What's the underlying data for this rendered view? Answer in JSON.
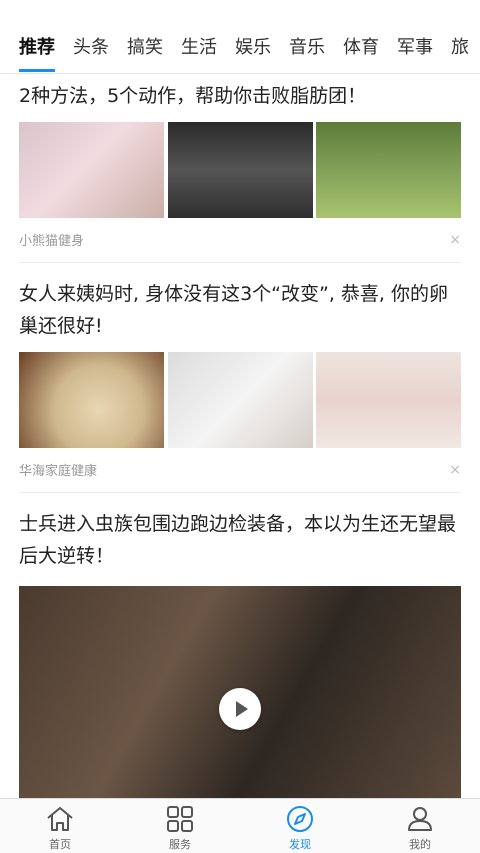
{
  "tabs": {
    "items": [
      {
        "label": "推荐",
        "active": true
      },
      {
        "label": "头条",
        "active": false
      },
      {
        "label": "搞笑",
        "active": false
      },
      {
        "label": "生活",
        "active": false
      },
      {
        "label": "娱乐",
        "active": false
      },
      {
        "label": "音乐",
        "active": false
      },
      {
        "label": "体育",
        "active": false
      },
      {
        "label": "军事",
        "active": false
      },
      {
        "label": "旅",
        "active": false
      }
    ],
    "accent_color": "#1a8cf0"
  },
  "feed": {
    "articles": [
      {
        "title": "2种方法，5个动作，帮助你击败脂肪团！",
        "source": "小熊猫健身",
        "close_symbol": "×"
      },
      {
        "title": "女人来姨妈时, 身体没有这3个“改变”, 恭喜, 你的卵巢还很好!",
        "source": "华海家庭健康",
        "close_symbol": "×"
      },
      {
        "title": "士兵进入虫族包围边跑边检装备，本以为生还无望最后大逆转！"
      }
    ]
  },
  "bottom_nav": {
    "items": [
      {
        "label": "首页",
        "icon": "home-icon"
      },
      {
        "label": "服务",
        "icon": "grid-icon"
      },
      {
        "label": "发现",
        "icon": "compass-icon",
        "active": true
      },
      {
        "label": "我的",
        "icon": "user-icon"
      }
    ]
  }
}
